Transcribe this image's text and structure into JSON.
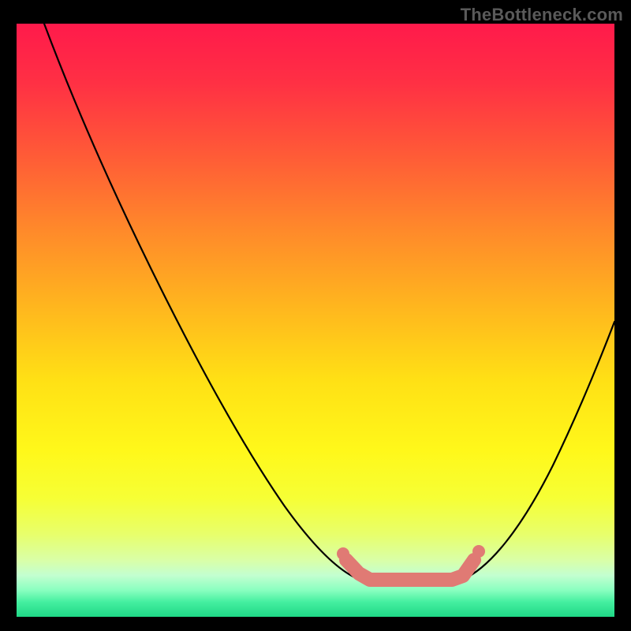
{
  "watermark": "TheBottleneck.com",
  "chart_data": {
    "type": "line",
    "title": "",
    "xlabel": "",
    "ylabel": "",
    "xlim": [
      0,
      100
    ],
    "ylim": [
      0,
      100
    ],
    "grid": false,
    "legend": false,
    "background": {
      "style": "vertical-gradient",
      "meaning": "heat scale (red=bad/high, green=good/low)",
      "stops": [
        {
          "pos": 0.0,
          "color": "#ff1a4b"
        },
        {
          "pos": 0.35,
          "color": "#ff8a2a"
        },
        {
          "pos": 0.72,
          "color": "#fff81a"
        },
        {
          "pos": 1.0,
          "color": "#1fd886"
        }
      ]
    },
    "series": [
      {
        "name": "left-branch",
        "color": "#000000",
        "x": [
          7,
          12,
          18,
          25,
          32,
          40,
          47,
          54,
          58
        ],
        "y": [
          100,
          84,
          70,
          55,
          41,
          27,
          16,
          8,
          6
        ]
      },
      {
        "name": "right-branch",
        "color": "#000000",
        "x": [
          75,
          79,
          84,
          89,
          94,
          100
        ],
        "y": [
          6,
          9,
          17,
          27,
          38,
          50
        ]
      },
      {
        "name": "optimal-range",
        "color": "#e07a74",
        "style": "thick-marker-band",
        "x": [
          55,
          57,
          59,
          63,
          67,
          71,
          73,
          75,
          77
        ],
        "y": [
          10,
          7.5,
          6,
          6,
          6,
          6,
          6.5,
          8,
          10.5
        ]
      }
    ],
    "annotations": [
      {
        "text": "TheBottleneck.com",
        "role": "watermark",
        "position": "top-right",
        "color": "#5a5a5a"
      }
    ]
  }
}
